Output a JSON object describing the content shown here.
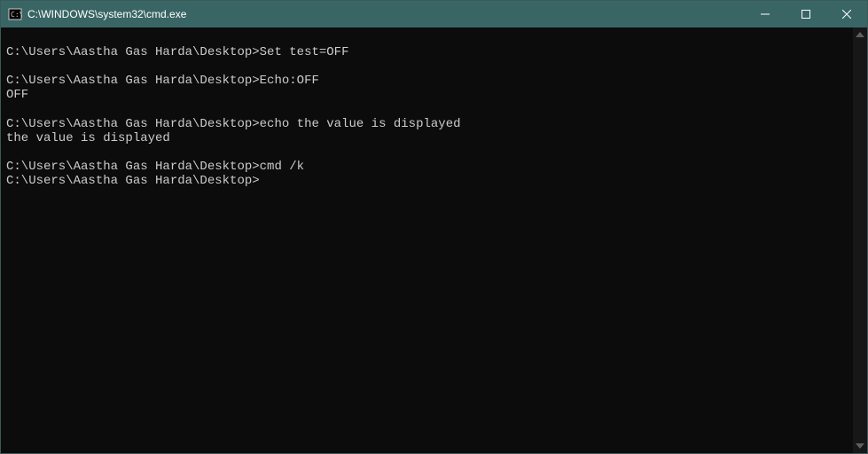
{
  "titlebar": {
    "title": "C:\\WINDOWS\\system32\\cmd.exe"
  },
  "terminal": {
    "lines": [
      {
        "type": "blank"
      },
      {
        "type": "cmd",
        "prompt": "C:\\Users\\Aastha Gas Harda\\Desktop>",
        "command": "Set test=OFF"
      },
      {
        "type": "blank"
      },
      {
        "type": "cmd",
        "prompt": "C:\\Users\\Aastha Gas Harda\\Desktop>",
        "command": "Echo:OFF"
      },
      {
        "type": "out",
        "text": "OFF"
      },
      {
        "type": "blank"
      },
      {
        "type": "cmd",
        "prompt": "C:\\Users\\Aastha Gas Harda\\Desktop>",
        "command": "echo the value is displayed"
      },
      {
        "type": "out",
        "text": "the value is displayed"
      },
      {
        "type": "blank"
      },
      {
        "type": "cmd",
        "prompt": "C:\\Users\\Aastha Gas Harda\\Desktop>",
        "command": "cmd /k"
      },
      {
        "type": "cmd",
        "prompt": "C:\\Users\\Aastha Gas Harda\\Desktop>",
        "command": ""
      }
    ]
  }
}
